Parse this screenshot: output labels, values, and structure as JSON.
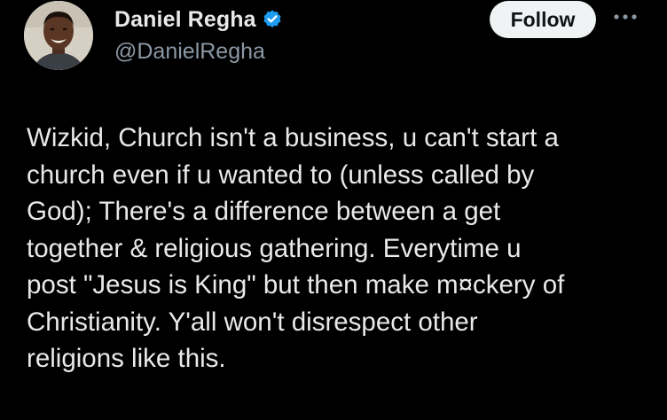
{
  "author": {
    "display_name": "Daniel Regha",
    "handle": "@DanielRegha",
    "verified": true
  },
  "actions": {
    "follow_label": "Follow",
    "more_icon": "more-horizontal-icon"
  },
  "tweet": {
    "text": "Wizkid, Church isn't a business, u can't start a\nchurch even if u wanted to (unless called by\nGod); There's a difference between a get\ntogether & religious gathering. Everytime u\npost \"Jesus is King\" but then make m¤ckery of\nChristianity. Y'all won't disrespect other\nreligions like this."
  },
  "colors": {
    "background": "#000000",
    "primary_text": "#e7e9ea",
    "secondary_text": "#8b98a5",
    "verified_blue": "#1d9bf0",
    "follow_button_bg": "#eff3f4",
    "follow_button_text": "#0f1419"
  }
}
